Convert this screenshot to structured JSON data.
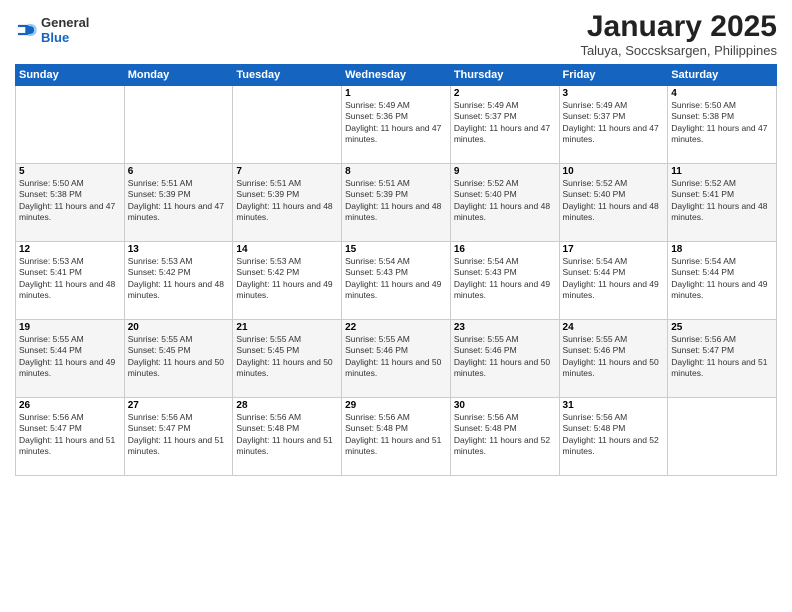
{
  "logo": {
    "general": "General",
    "blue": "Blue"
  },
  "title": "January 2025",
  "subtitle": "Taluya, Soccsksargen, Philippines",
  "days_of_week": [
    "Sunday",
    "Monday",
    "Tuesday",
    "Wednesday",
    "Thursday",
    "Friday",
    "Saturday"
  ],
  "weeks": [
    {
      "cells": [
        {
          "day": "",
          "content": ""
        },
        {
          "day": "",
          "content": ""
        },
        {
          "day": "",
          "content": ""
        },
        {
          "day": "1",
          "content": "Sunrise: 5:49 AM\nSunset: 5:36 PM\nDaylight: 11 hours and 47 minutes."
        },
        {
          "day": "2",
          "content": "Sunrise: 5:49 AM\nSunset: 5:37 PM\nDaylight: 11 hours and 47 minutes."
        },
        {
          "day": "3",
          "content": "Sunrise: 5:49 AM\nSunset: 5:37 PM\nDaylight: 11 hours and 47 minutes."
        },
        {
          "day": "4",
          "content": "Sunrise: 5:50 AM\nSunset: 5:38 PM\nDaylight: 11 hours and 47 minutes."
        }
      ]
    },
    {
      "cells": [
        {
          "day": "5",
          "content": "Sunrise: 5:50 AM\nSunset: 5:38 PM\nDaylight: 11 hours and 47 minutes."
        },
        {
          "day": "6",
          "content": "Sunrise: 5:51 AM\nSunset: 5:39 PM\nDaylight: 11 hours and 47 minutes."
        },
        {
          "day": "7",
          "content": "Sunrise: 5:51 AM\nSunset: 5:39 PM\nDaylight: 11 hours and 48 minutes."
        },
        {
          "day": "8",
          "content": "Sunrise: 5:51 AM\nSunset: 5:39 PM\nDaylight: 11 hours and 48 minutes."
        },
        {
          "day": "9",
          "content": "Sunrise: 5:52 AM\nSunset: 5:40 PM\nDaylight: 11 hours and 48 minutes."
        },
        {
          "day": "10",
          "content": "Sunrise: 5:52 AM\nSunset: 5:40 PM\nDaylight: 11 hours and 48 minutes."
        },
        {
          "day": "11",
          "content": "Sunrise: 5:52 AM\nSunset: 5:41 PM\nDaylight: 11 hours and 48 minutes."
        }
      ]
    },
    {
      "cells": [
        {
          "day": "12",
          "content": "Sunrise: 5:53 AM\nSunset: 5:41 PM\nDaylight: 11 hours and 48 minutes."
        },
        {
          "day": "13",
          "content": "Sunrise: 5:53 AM\nSunset: 5:42 PM\nDaylight: 11 hours and 48 minutes."
        },
        {
          "day": "14",
          "content": "Sunrise: 5:53 AM\nSunset: 5:42 PM\nDaylight: 11 hours and 49 minutes."
        },
        {
          "day": "15",
          "content": "Sunrise: 5:54 AM\nSunset: 5:43 PM\nDaylight: 11 hours and 49 minutes."
        },
        {
          "day": "16",
          "content": "Sunrise: 5:54 AM\nSunset: 5:43 PM\nDaylight: 11 hours and 49 minutes."
        },
        {
          "day": "17",
          "content": "Sunrise: 5:54 AM\nSunset: 5:44 PM\nDaylight: 11 hours and 49 minutes."
        },
        {
          "day": "18",
          "content": "Sunrise: 5:54 AM\nSunset: 5:44 PM\nDaylight: 11 hours and 49 minutes."
        }
      ]
    },
    {
      "cells": [
        {
          "day": "19",
          "content": "Sunrise: 5:55 AM\nSunset: 5:44 PM\nDaylight: 11 hours and 49 minutes."
        },
        {
          "day": "20",
          "content": "Sunrise: 5:55 AM\nSunset: 5:45 PM\nDaylight: 11 hours and 50 minutes."
        },
        {
          "day": "21",
          "content": "Sunrise: 5:55 AM\nSunset: 5:45 PM\nDaylight: 11 hours and 50 minutes."
        },
        {
          "day": "22",
          "content": "Sunrise: 5:55 AM\nSunset: 5:46 PM\nDaylight: 11 hours and 50 minutes."
        },
        {
          "day": "23",
          "content": "Sunrise: 5:55 AM\nSunset: 5:46 PM\nDaylight: 11 hours and 50 minutes."
        },
        {
          "day": "24",
          "content": "Sunrise: 5:55 AM\nSunset: 5:46 PM\nDaylight: 11 hours and 50 minutes."
        },
        {
          "day": "25",
          "content": "Sunrise: 5:56 AM\nSunset: 5:47 PM\nDaylight: 11 hours and 51 minutes."
        }
      ]
    },
    {
      "cells": [
        {
          "day": "26",
          "content": "Sunrise: 5:56 AM\nSunset: 5:47 PM\nDaylight: 11 hours and 51 minutes."
        },
        {
          "day": "27",
          "content": "Sunrise: 5:56 AM\nSunset: 5:47 PM\nDaylight: 11 hours and 51 minutes."
        },
        {
          "day": "28",
          "content": "Sunrise: 5:56 AM\nSunset: 5:48 PM\nDaylight: 11 hours and 51 minutes."
        },
        {
          "day": "29",
          "content": "Sunrise: 5:56 AM\nSunset: 5:48 PM\nDaylight: 11 hours and 51 minutes."
        },
        {
          "day": "30",
          "content": "Sunrise: 5:56 AM\nSunset: 5:48 PM\nDaylight: 11 hours and 52 minutes."
        },
        {
          "day": "31",
          "content": "Sunrise: 5:56 AM\nSunset: 5:48 PM\nDaylight: 11 hours and 52 minutes."
        },
        {
          "day": "",
          "content": ""
        }
      ]
    }
  ]
}
